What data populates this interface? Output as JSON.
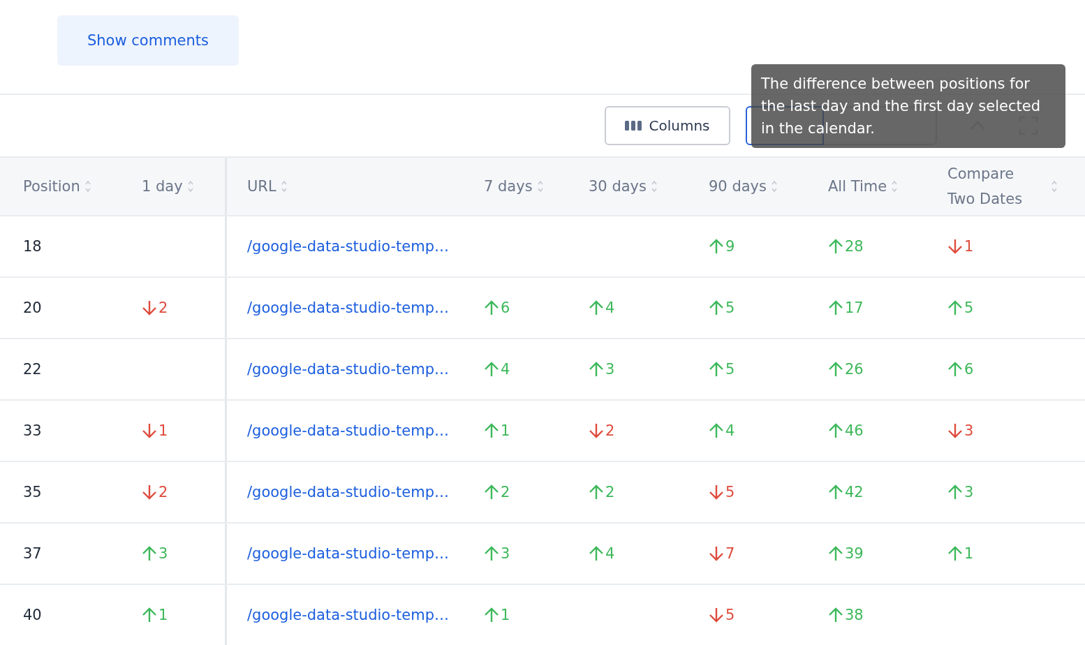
{
  "show_comments_button": "Show comments",
  "toolbar": {
    "columns_button": "Columns"
  },
  "tooltip": "The difference between positions for the last day and the first day selected in the calendar.",
  "table": {
    "columns": [
      "Position",
      "1 day",
      "URL",
      "7 days",
      "30 days",
      "90 days",
      "All Time",
      "Compare Two Dates"
    ],
    "rows": [
      {
        "cells": [
          {
            "kind": "text",
            "text": "18"
          },
          {
            "kind": "empty"
          },
          {
            "kind": "link",
            "text": "/google-data-studio-temp…"
          },
          {
            "kind": "empty"
          },
          {
            "kind": "empty"
          },
          {
            "kind": "change",
            "rising": true,
            "text": "9"
          },
          {
            "kind": "change",
            "rising": true,
            "text": "28"
          },
          {
            "kind": "change",
            "rising": false,
            "text": "1"
          }
        ]
      },
      {
        "cells": [
          {
            "kind": "text",
            "text": "20"
          },
          {
            "kind": "change",
            "rising": false,
            "text": "2"
          },
          {
            "kind": "link",
            "text": "/google-data-studio-temp…"
          },
          {
            "kind": "change",
            "rising": true,
            "text": "6"
          },
          {
            "kind": "change",
            "rising": true,
            "text": "4"
          },
          {
            "kind": "change",
            "rising": true,
            "text": "5"
          },
          {
            "kind": "change",
            "rising": true,
            "text": "17"
          },
          {
            "kind": "change",
            "rising": true,
            "text": "5"
          }
        ]
      },
      {
        "cells": [
          {
            "kind": "text",
            "text": "22"
          },
          {
            "kind": "empty"
          },
          {
            "kind": "link",
            "text": "/google-data-studio-temp…"
          },
          {
            "kind": "change",
            "rising": true,
            "text": "4"
          },
          {
            "kind": "change",
            "rising": true,
            "text": "3"
          },
          {
            "kind": "change",
            "rising": true,
            "text": "5"
          },
          {
            "kind": "change",
            "rising": true,
            "text": "26"
          },
          {
            "kind": "change",
            "rising": true,
            "text": "6"
          }
        ]
      },
      {
        "cells": [
          {
            "kind": "text",
            "text": "33"
          },
          {
            "kind": "change",
            "rising": false,
            "text": "1"
          },
          {
            "kind": "link",
            "text": "/google-data-studio-temp…"
          },
          {
            "kind": "change",
            "rising": true,
            "text": "1"
          },
          {
            "kind": "change",
            "rising": false,
            "text": "2"
          },
          {
            "kind": "change",
            "rising": true,
            "text": "4"
          },
          {
            "kind": "change",
            "rising": true,
            "text": "46"
          },
          {
            "kind": "change",
            "rising": false,
            "text": "3"
          }
        ]
      },
      {
        "cells": [
          {
            "kind": "text",
            "text": "35"
          },
          {
            "kind": "change",
            "rising": false,
            "text": "2"
          },
          {
            "kind": "link",
            "text": "/google-data-studio-temp…"
          },
          {
            "kind": "change",
            "rising": true,
            "text": "2"
          },
          {
            "kind": "change",
            "rising": true,
            "text": "2"
          },
          {
            "kind": "change",
            "rising": false,
            "text": "5"
          },
          {
            "kind": "change",
            "rising": true,
            "text": "42"
          },
          {
            "kind": "change",
            "rising": true,
            "text": "3"
          }
        ]
      },
      {
        "cells": [
          {
            "kind": "text",
            "text": "37"
          },
          {
            "kind": "change",
            "rising": true,
            "text": "3"
          },
          {
            "kind": "link",
            "text": "/google-data-studio-temp…"
          },
          {
            "kind": "change",
            "rising": true,
            "text": "3"
          },
          {
            "kind": "change",
            "rising": true,
            "text": "4"
          },
          {
            "kind": "change",
            "rising": false,
            "text": "7"
          },
          {
            "kind": "change",
            "rising": true,
            "text": "39"
          },
          {
            "kind": "change",
            "rising": true,
            "text": "1"
          }
        ]
      },
      {
        "cells": [
          {
            "kind": "text",
            "text": "40"
          },
          {
            "kind": "change",
            "rising": true,
            "text": "1"
          },
          {
            "kind": "link",
            "text": "/google-data-studio-temp…"
          },
          {
            "kind": "change",
            "rising": true,
            "text": "1"
          },
          {
            "kind": "empty"
          },
          {
            "kind": "change",
            "rising": false,
            "text": "5"
          },
          {
            "kind": "change",
            "rising": true,
            "text": "38"
          },
          {
            "kind": "empty"
          }
        ]
      }
    ]
  }
}
